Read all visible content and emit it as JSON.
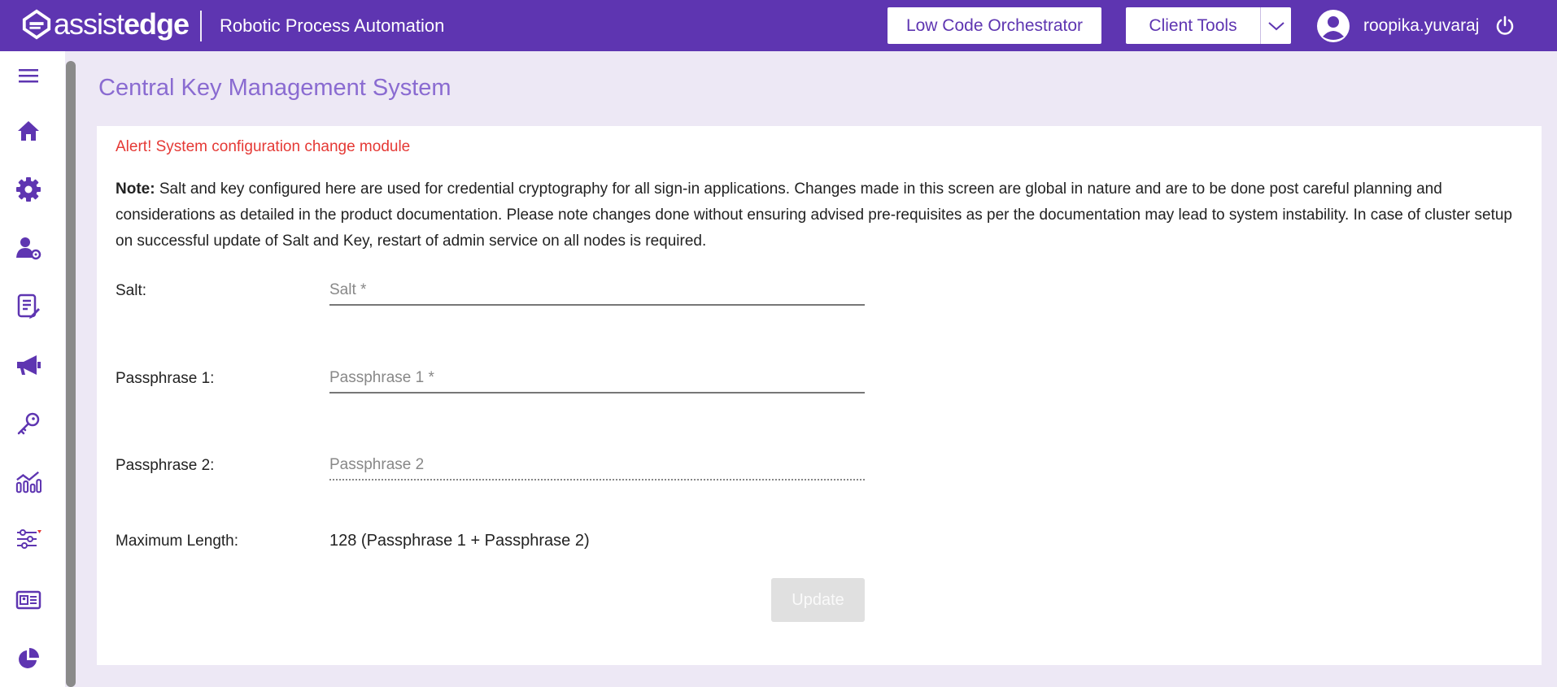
{
  "header": {
    "logo_light": "assist",
    "logo_bold": "edge",
    "app_title": "Robotic Process Automation",
    "low_code_button": "Low Code Orchestrator",
    "client_tools_button": "Client Tools",
    "username": "roopika.yuvaraj"
  },
  "sidebar": {
    "items": [
      {
        "icon": "menu-icon"
      },
      {
        "icon": "home-icon"
      },
      {
        "icon": "gear-icon"
      },
      {
        "icon": "user-settings-icon"
      },
      {
        "icon": "document-edit-icon"
      },
      {
        "icon": "megaphone-icon"
      },
      {
        "icon": "key-icon"
      },
      {
        "icon": "analytics-icon"
      },
      {
        "icon": "sliders-icon"
      },
      {
        "icon": "id-card-icon"
      },
      {
        "icon": "pie-chart-icon"
      }
    ]
  },
  "page": {
    "title": "Central Key Management System",
    "alert": "Alert! System configuration change module",
    "note_label": "Note:",
    "note_text": " Salt and key configured here are used for credential cryptography for all sign-in applications. Changes made in this screen are global in nature and are to be done post careful planning and considerations as detailed in the product documentation. Please note changes done without ensuring advised pre-requisites as per the documentation may lead to system instability. In case of cluster setup on successful update of Salt and Key, restart of admin service on all nodes is required.",
    "salt_label": "Salt:",
    "salt_placeholder": "Salt *",
    "salt_value": "",
    "pass1_label": "Passphrase 1:",
    "pass1_placeholder": "Passphrase 1 *",
    "pass1_value": "",
    "pass2_label": "Passphrase 2:",
    "pass2_placeholder": "Passphrase 2",
    "pass2_value": "",
    "max_length_label": "Maximum Length:",
    "max_length_value": "128 (Passphrase 1 + Passphrase 2)",
    "update_button": "Update"
  },
  "colors": {
    "brand": "#5e35b1",
    "page_bg": "#ede8f5",
    "title": "#8a6bd1",
    "alert": "#e53935"
  }
}
